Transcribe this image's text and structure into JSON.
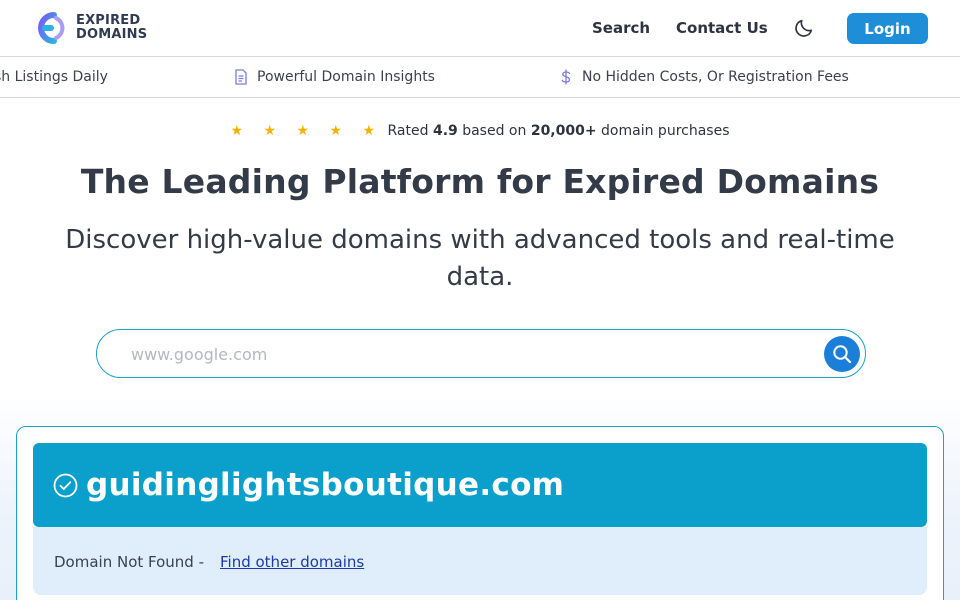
{
  "brand": {
    "line1": "EXPIRED",
    "line2": "DOMAINS",
    "accent": "#1e8ed8"
  },
  "nav": {
    "search": "Search",
    "contact": "Contact Us",
    "login": "Login",
    "theme_icon": "moon-icon"
  },
  "ticker": [
    {
      "icon": "",
      "text": "sh Listings Daily"
    },
    {
      "icon": "document-icon",
      "text": "Powerful Domain Insights"
    },
    {
      "icon": "dollar-icon",
      "text": "No Hidden Costs, Or Registration Fees"
    }
  ],
  "rating": {
    "stars": "★ ★ ★ ★ ★",
    "prefix": "Rated",
    "score": "4.9",
    "middle": "based on",
    "count": "20,000+",
    "suffix": "domain purchases"
  },
  "hero": {
    "title": "The Leading Platform for Expired Domains",
    "subtitle": "Discover high-value domains with advanced tools and real-time data."
  },
  "search": {
    "placeholder": "www.google.com",
    "value": ""
  },
  "result": {
    "domain": "guidinglightsboutique.com",
    "status": "Domain Not Found -",
    "link": "Find other domains",
    "header_color": "#0aa0cb"
  }
}
